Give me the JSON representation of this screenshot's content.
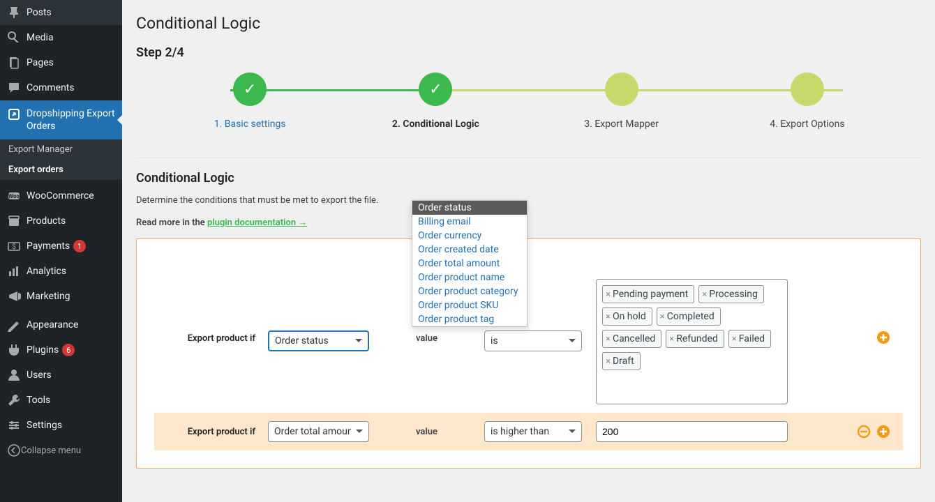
{
  "sidebar": {
    "items": [
      {
        "label": "Posts"
      },
      {
        "label": "Media"
      },
      {
        "label": "Pages"
      },
      {
        "label": "Comments"
      },
      {
        "label": "Dropshipping Export Orders"
      },
      {
        "label": "WooCommerce"
      },
      {
        "label": "Products"
      },
      {
        "label": "Payments",
        "badge": "1"
      },
      {
        "label": "Analytics"
      },
      {
        "label": "Marketing"
      },
      {
        "label": "Appearance"
      },
      {
        "label": "Plugins",
        "badge": "6"
      },
      {
        "label": "Users"
      },
      {
        "label": "Tools"
      },
      {
        "label": "Settings"
      }
    ],
    "submenu": [
      {
        "label": "Export Manager"
      },
      {
        "label": "Export orders"
      }
    ],
    "collapse": "Collapse menu"
  },
  "page": {
    "title": "Conditional Logic",
    "step_title": "Step 2/4",
    "steps": [
      {
        "label": "1. Basic settings"
      },
      {
        "label": "2. Conditional Logic"
      },
      {
        "label": "3. Export Mapper"
      },
      {
        "label": "4. Export Options"
      }
    ],
    "section_heading": "Conditional Logic",
    "description": "Determine the conditions that must be met to export the file.",
    "doc_prefix": "Read more in the ",
    "doc_link": "plugin documentation →"
  },
  "dropdown": {
    "options": [
      "Order status",
      "Billing email",
      "Order currency",
      "Order created date",
      "Order total amount",
      "Order product name",
      "Order product category",
      "Order product SKU",
      "Order product tag"
    ]
  },
  "row1": {
    "label": "Export product if",
    "field": "Order status",
    "value_label": "value",
    "operator": "is",
    "tags": [
      "Pending payment",
      "Processing",
      "On hold",
      "Completed",
      "Cancelled",
      "Refunded",
      "Failed",
      "Draft"
    ]
  },
  "row2": {
    "label": "Export product if",
    "field": "Order total amount",
    "value_label": "value",
    "operator": "is higher than",
    "value": "200"
  }
}
